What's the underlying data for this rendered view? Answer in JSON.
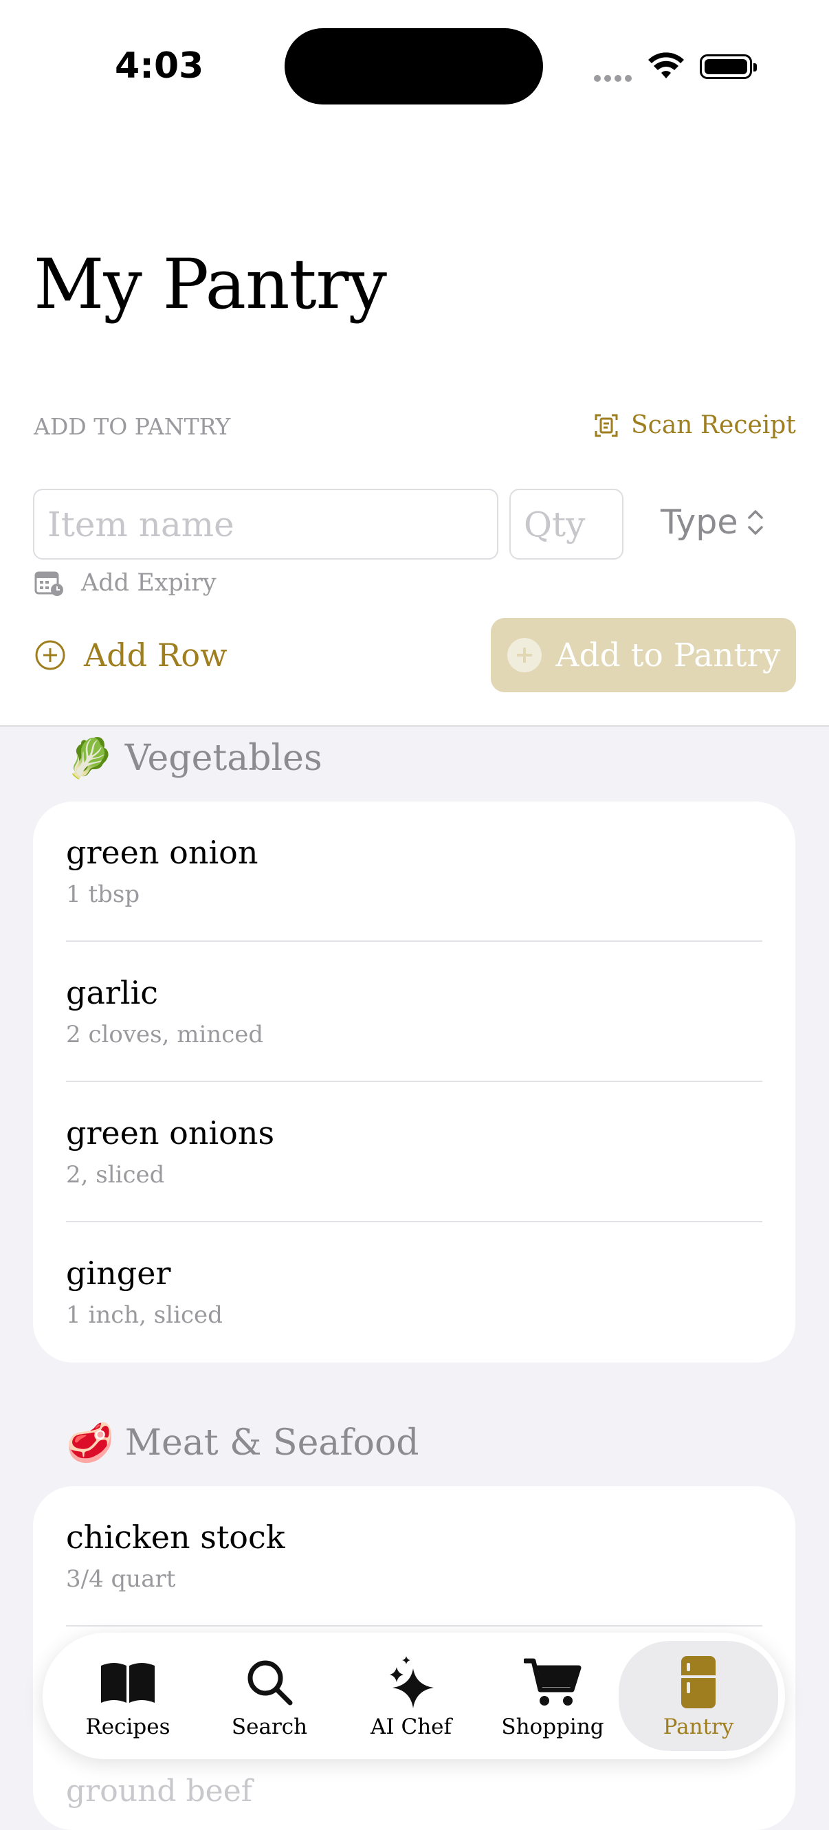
{
  "status": {
    "time": "4:03"
  },
  "page": {
    "title": "My Pantry"
  },
  "add_section": {
    "label": "ADD TO PANTRY",
    "scan_label": "Scan Receipt",
    "item_placeholder": "Item name",
    "qty_placeholder": "Qty",
    "type_label": "Type",
    "expiry_label": "Add Expiry",
    "add_row_label": "Add Row",
    "add_button_label": "Add to Pantry"
  },
  "categories": [
    {
      "emoji": "🥬",
      "name": "Vegetables",
      "items": [
        {
          "name": "green onion",
          "qty": "1 tbsp"
        },
        {
          "name": "garlic",
          "qty": "2 cloves, minced"
        },
        {
          "name": "green onions",
          "qty": "2, sliced"
        },
        {
          "name": "ginger",
          "qty": "1 inch, sliced"
        }
      ]
    },
    {
      "emoji": "🥩",
      "name": "Meat & Seafood",
      "items": [
        {
          "name": "chicken stock",
          "qty": "3/4 quart"
        },
        {
          "name": "",
          "qty": ""
        },
        {
          "name": "ground beef",
          "qty": ""
        }
      ]
    }
  ],
  "tabbar": {
    "tabs": [
      {
        "label": "Recipes",
        "icon": "book-icon"
      },
      {
        "label": "Search",
        "icon": "search-icon"
      },
      {
        "label": "AI Chef",
        "icon": "sparkles-icon"
      },
      {
        "label": "Shopping",
        "icon": "cart-icon"
      },
      {
        "label": "Pantry",
        "icon": "refrigerator-icon",
        "active": true
      }
    ]
  },
  "colors": {
    "accent": "#9e7e1e",
    "accent_disabled": "#e1d7b4",
    "background": "#f2f2f7"
  }
}
